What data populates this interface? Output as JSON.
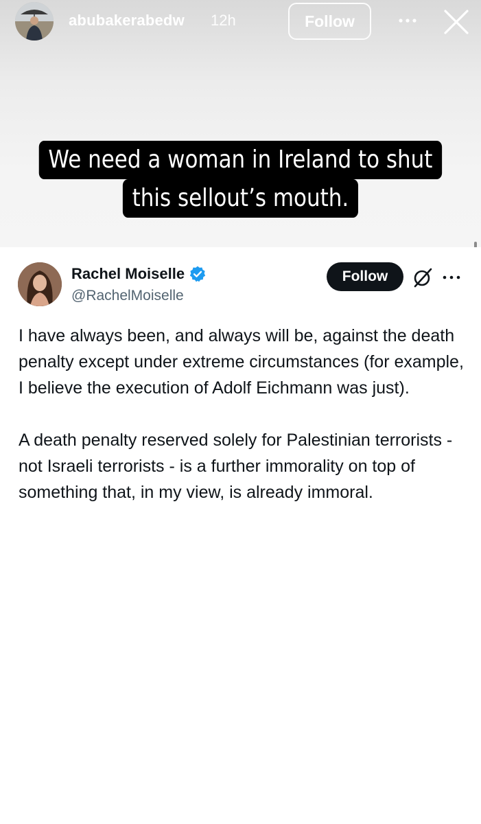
{
  "story": {
    "username": "abubakerabedw",
    "time_ago": "12h",
    "follow_label": "Follow",
    "more_icon": "more-horizontal-icon",
    "close_icon": "close-icon",
    "caption_lines": [
      "We need a woman in Ireland to shut",
      "this sellout’s mouth."
    ]
  },
  "tweet": {
    "display_name": "Rachel Moiselle",
    "handle": "@RachelMoiselle",
    "verified": true,
    "follow_label": "Follow",
    "grok_icon": "grok-icon",
    "more_icon": "more-horizontal-icon",
    "paragraphs": [
      "I have always been, and always will be, against the death penalty except under extreme circumstances (for example, I believe the execution of Adolf Eichmann was just).",
      "A death penalty reserved solely for Palestinian terrorists - not Israeli terrorists - is a further immorality on top of something that, in my view, is already immoral."
    ]
  },
  "colors": {
    "verified_badge": "#1d9bf0",
    "follow_button_bg": "#0f1419",
    "handle_text": "#536471",
    "caption_bg": "#000000"
  }
}
